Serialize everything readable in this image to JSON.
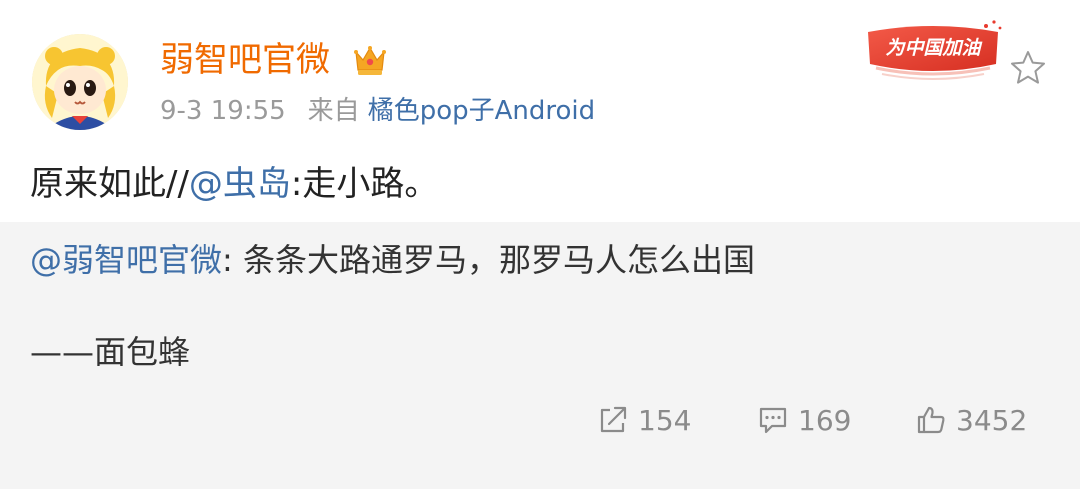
{
  "header": {
    "username": "弱智吧官微",
    "timestamp": "9-3 19:55",
    "from_label": "来自",
    "source": "橘色pop子Android",
    "badge_text": "为中国加油",
    "icons": {
      "avatar": "anime-avatar",
      "crown": "crown-icon",
      "favorite": "star-icon"
    }
  },
  "post": {
    "text_prefix": "原来如此//",
    "mention": "@虫岛",
    "text_suffix": ":走小路。"
  },
  "repost": {
    "author": "@弱智吧官微",
    "body": ": 条条大路通罗马，那罗马人怎么出国",
    "signature": "——面包蜂"
  },
  "actions": {
    "repost_count": "154",
    "comment_count": "169",
    "like_count": "3452",
    "icons": [
      "share-icon",
      "comment-icon",
      "like-icon"
    ]
  },
  "colors": {
    "username": "#f06a00",
    "link": "#3f6fa8",
    "meta": "#9a9a9a",
    "repost_bg": "#f4f4f4",
    "badge": "#e83a2e"
  }
}
